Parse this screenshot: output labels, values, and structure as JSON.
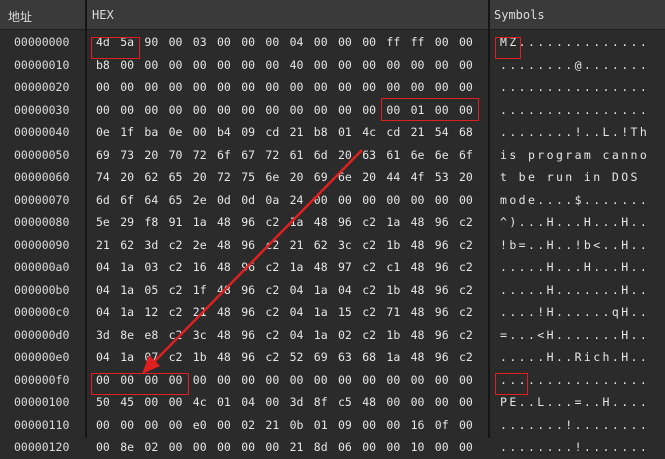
{
  "header": {
    "address_label": "地址",
    "hex_label": "HEX",
    "symbols_label": "Symbols"
  },
  "rows": [
    {
      "addr": "00000000",
      "bytes": [
        "4d",
        "5a",
        "90",
        "00",
        "03",
        "00",
        "00",
        "00",
        "04",
        "00",
        "00",
        "00",
        "ff",
        "ff",
        "00",
        "00"
      ],
      "text": "MZ.............."
    },
    {
      "addr": "00000010",
      "bytes": [
        "b8",
        "00",
        "00",
        "00",
        "00",
        "00",
        "00",
        "00",
        "40",
        "00",
        "00",
        "00",
        "00",
        "00",
        "00",
        "00"
      ],
      "text": "........@......."
    },
    {
      "addr": "00000020",
      "bytes": [
        "00",
        "00",
        "00",
        "00",
        "00",
        "00",
        "00",
        "00",
        "00",
        "00",
        "00",
        "00",
        "00",
        "00",
        "00",
        "00"
      ],
      "text": "................"
    },
    {
      "addr": "00000030",
      "bytes": [
        "00",
        "00",
        "00",
        "00",
        "00",
        "00",
        "00",
        "00",
        "00",
        "00",
        "00",
        "00",
        "00",
        "01",
        "00",
        "00"
      ],
      "text": "................"
    },
    {
      "addr": "00000040",
      "bytes": [
        "0e",
        "1f",
        "ba",
        "0e",
        "00",
        "b4",
        "09",
        "cd",
        "21",
        "b8",
        "01",
        "4c",
        "cd",
        "21",
        "54",
        "68"
      ],
      "text": "........!..L.!Th"
    },
    {
      "addr": "00000050",
      "bytes": [
        "69",
        "73",
        "20",
        "70",
        "72",
        "6f",
        "67",
        "72",
        "61",
        "6d",
        "20",
        "63",
        "61",
        "6e",
        "6e",
        "6f"
      ],
      "text": "is program canno"
    },
    {
      "addr": "00000060",
      "bytes": [
        "74",
        "20",
        "62",
        "65",
        "20",
        "72",
        "75",
        "6e",
        "20",
        "69",
        "6e",
        "20",
        "44",
        "4f",
        "53",
        "20"
      ],
      "text": "t be run in DOS "
    },
    {
      "addr": "00000070",
      "bytes": [
        "6d",
        "6f",
        "64",
        "65",
        "2e",
        "0d",
        "0d",
        "0a",
        "24",
        "00",
        "00",
        "00",
        "00",
        "00",
        "00",
        "00"
      ],
      "text": "mode....$......."
    },
    {
      "addr": "00000080",
      "bytes": [
        "5e",
        "29",
        "f8",
        "91",
        "1a",
        "48",
        "96",
        "c2",
        "1a",
        "48",
        "96",
        "c2",
        "1a",
        "48",
        "96",
        "c2"
      ],
      "text": "^)...H...H...H.."
    },
    {
      "addr": "00000090",
      "bytes": [
        "21",
        "62",
        "3d",
        "c2",
        "2e",
        "48",
        "96",
        "c2",
        "21",
        "62",
        "3c",
        "c2",
        "1b",
        "48",
        "96",
        "c2"
      ],
      "text": "!b=..H..!b<..H.."
    },
    {
      "addr": "000000a0",
      "bytes": [
        "04",
        "1a",
        "03",
        "c2",
        "16",
        "48",
        "96",
        "c2",
        "1a",
        "48",
        "97",
        "c2",
        "c1",
        "48",
        "96",
        "c2"
      ],
      "text": ".....H...H...H.."
    },
    {
      "addr": "000000b0",
      "bytes": [
        "04",
        "1a",
        "05",
        "c2",
        "1f",
        "48",
        "96",
        "c2",
        "04",
        "1a",
        "04",
        "c2",
        "1b",
        "48",
        "96",
        "c2"
      ],
      "text": ".....H.......H.."
    },
    {
      "addr": "000000c0",
      "bytes": [
        "04",
        "1a",
        "12",
        "c2",
        "21",
        "48",
        "96",
        "c2",
        "04",
        "1a",
        "15",
        "c2",
        "71",
        "48",
        "96",
        "c2"
      ],
      "text": "....!H......qH.."
    },
    {
      "addr": "000000d0",
      "bytes": [
        "3d",
        "8e",
        "e8",
        "c2",
        "3c",
        "48",
        "96",
        "c2",
        "04",
        "1a",
        "02",
        "c2",
        "1b",
        "48",
        "96",
        "c2"
      ],
      "text": "=...<H.......H.."
    },
    {
      "addr": "000000e0",
      "bytes": [
        "04",
        "1a",
        "07",
        "c2",
        "1b",
        "48",
        "96",
        "c2",
        "52",
        "69",
        "63",
        "68",
        "1a",
        "48",
        "96",
        "c2"
      ],
      "text": ".....H..Rich.H.."
    },
    {
      "addr": "000000f0",
      "bytes": [
        "00",
        "00",
        "00",
        "00",
        "00",
        "00",
        "00",
        "00",
        "00",
        "00",
        "00",
        "00",
        "00",
        "00",
        "00",
        "00"
      ],
      "text": "................"
    },
    {
      "addr": "00000100",
      "bytes": [
        "50",
        "45",
        "00",
        "00",
        "4c",
        "01",
        "04",
        "00",
        "3d",
        "8f",
        "c5",
        "48",
        "00",
        "00",
        "00",
        "00"
      ],
      "text": "PE..L...=..H...."
    },
    {
      "addr": "00000110",
      "bytes": [
        "00",
        "00",
        "00",
        "00",
        "e0",
        "00",
        "02",
        "21",
        "0b",
        "01",
        "09",
        "00",
        "00",
        "16",
        "0f",
        "00"
      ],
      "text": ".......!........"
    },
    {
      "addr": "00000120",
      "bytes": [
        "00",
        "8e",
        "02",
        "00",
        "00",
        "00",
        "00",
        "00",
        "21",
        "8d",
        "06",
        "00",
        "00",
        "10",
        "00",
        "00"
      ],
      "text": "........!......."
    }
  ]
}
